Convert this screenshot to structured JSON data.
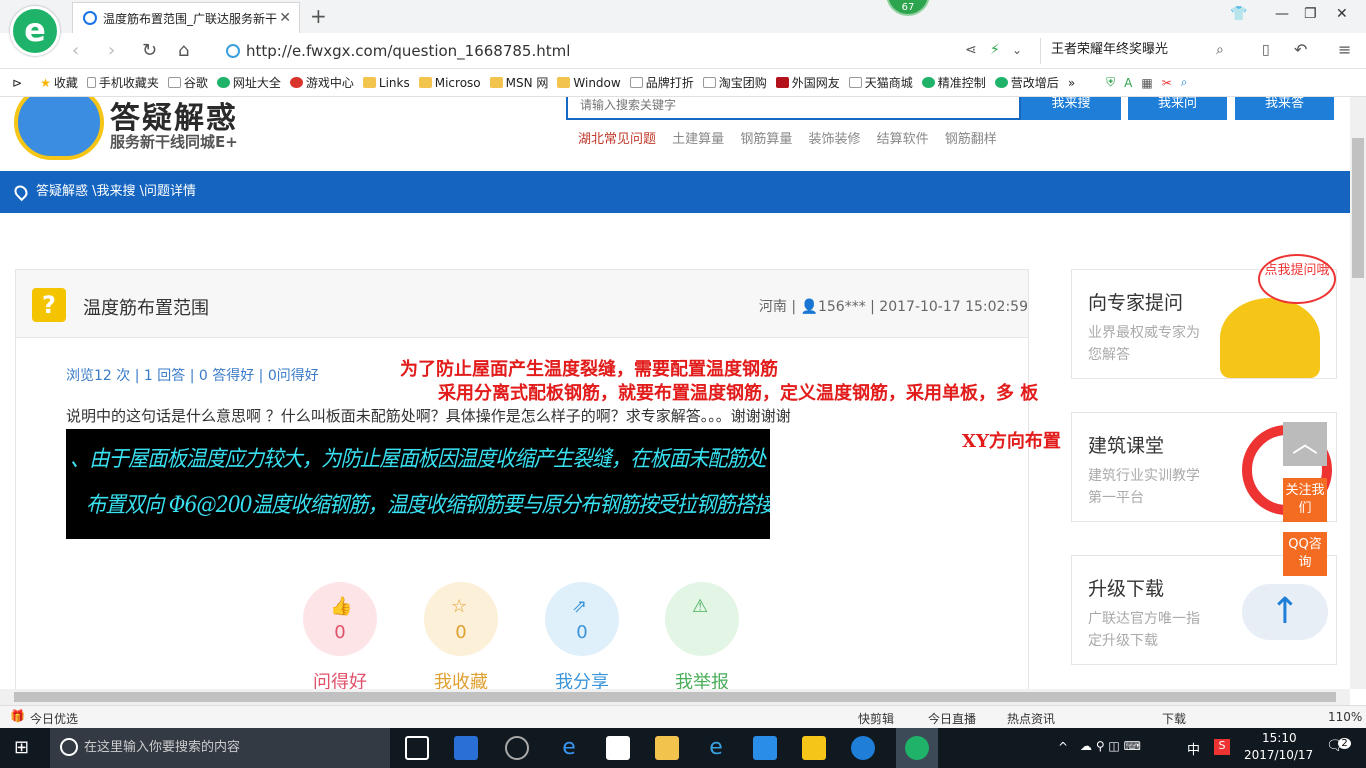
{
  "browser": {
    "tab_title": "温度筋布置范围_广联达服务新干",
    "notification_count": "67",
    "url": "http://e.fwxgx.com/question_1668785.html",
    "search_suggestion": "王者荣耀年终奖曝光"
  },
  "bookmarks": [
    "收藏",
    "手机收藏夹",
    "谷歌",
    "网址大全",
    "游戏中心",
    "Links",
    "Microso",
    "MSN 网",
    "Window",
    "品牌打折",
    "淘宝团购",
    "外国网友",
    "天猫商城",
    "精准控制",
    "营改增后"
  ],
  "site": {
    "logo_text": "答疑解惑",
    "slogan": "服务新干线同城E+",
    "search_placeholder": "请输入搜索关键字",
    "btn_search": "我来搜",
    "btn_ask": "我来问",
    "btn_answer": "我来答",
    "hot_links": [
      "湖北常见问题",
      "土建算量",
      "钢筋算量",
      "装饰装修",
      "结算软件",
      "钢筋翻样"
    ],
    "breadcrumb": "答疑解惑 \\我来搜 \\问题详情"
  },
  "question": {
    "title": "温度筋布置范围",
    "meta": "河南 | 👤156*** | 2017-10-17 15:02:59",
    "stats": "浏览12 次 | 1 回答 | 0 答得好 | 0问得好",
    "description": "说明中的这句话是什么意思啊 ？什么叫板面未配筋处啊？具体操作是怎么样子的啊？求专家解答。。。谢谢谢谢",
    "cad_line1": "、由于屋面板温度应力较大，为防止屋面板因温度收缩产生裂缝，在板面未配筋处",
    "cad_line2": "布置双向 Φ6@200温度收缩钢筋，温度收缩钢筋要与原分布钢筋按受拉钢筋搭接。",
    "annotation1": "为了防止屋面产生温度裂缝，需要配置温度钢筋",
    "annotation2": "采用分离式配板钢筋，就要布置温度钢筋，定义温度钢筋，采用单板，多 板",
    "annotation3": "XY方向布置",
    "actions": [
      {
        "label": "问得好",
        "count": "0"
      },
      {
        "label": "我收藏",
        "count": "0"
      },
      {
        "label": "我分享",
        "count": "0"
      },
      {
        "label": "我举报",
        "count": ""
      }
    ]
  },
  "sidebar": {
    "expert_title": "向专家提问",
    "expert_sub": "业界最权威专家为您解答",
    "expert_bubble": "点我提问哦",
    "course_title": "建筑课堂",
    "course_sub": "建筑行业实训教学第一平台",
    "download_title": "升级下载",
    "download_sub": "广联达官方唯一指定升级下载",
    "follow": "关注我们",
    "qq": "QQ咨询"
  },
  "statusbar": {
    "left": "今日优选",
    "items": [
      "快剪辑",
      "今日直播",
      "热点资讯",
      "下载"
    ],
    "zoom": "110%"
  },
  "taskbar": {
    "search_placeholder": "在这里输入你要搜索的内容",
    "ime": "中",
    "time": "15:10",
    "date": "2017/10/17",
    "notifications": "2"
  }
}
